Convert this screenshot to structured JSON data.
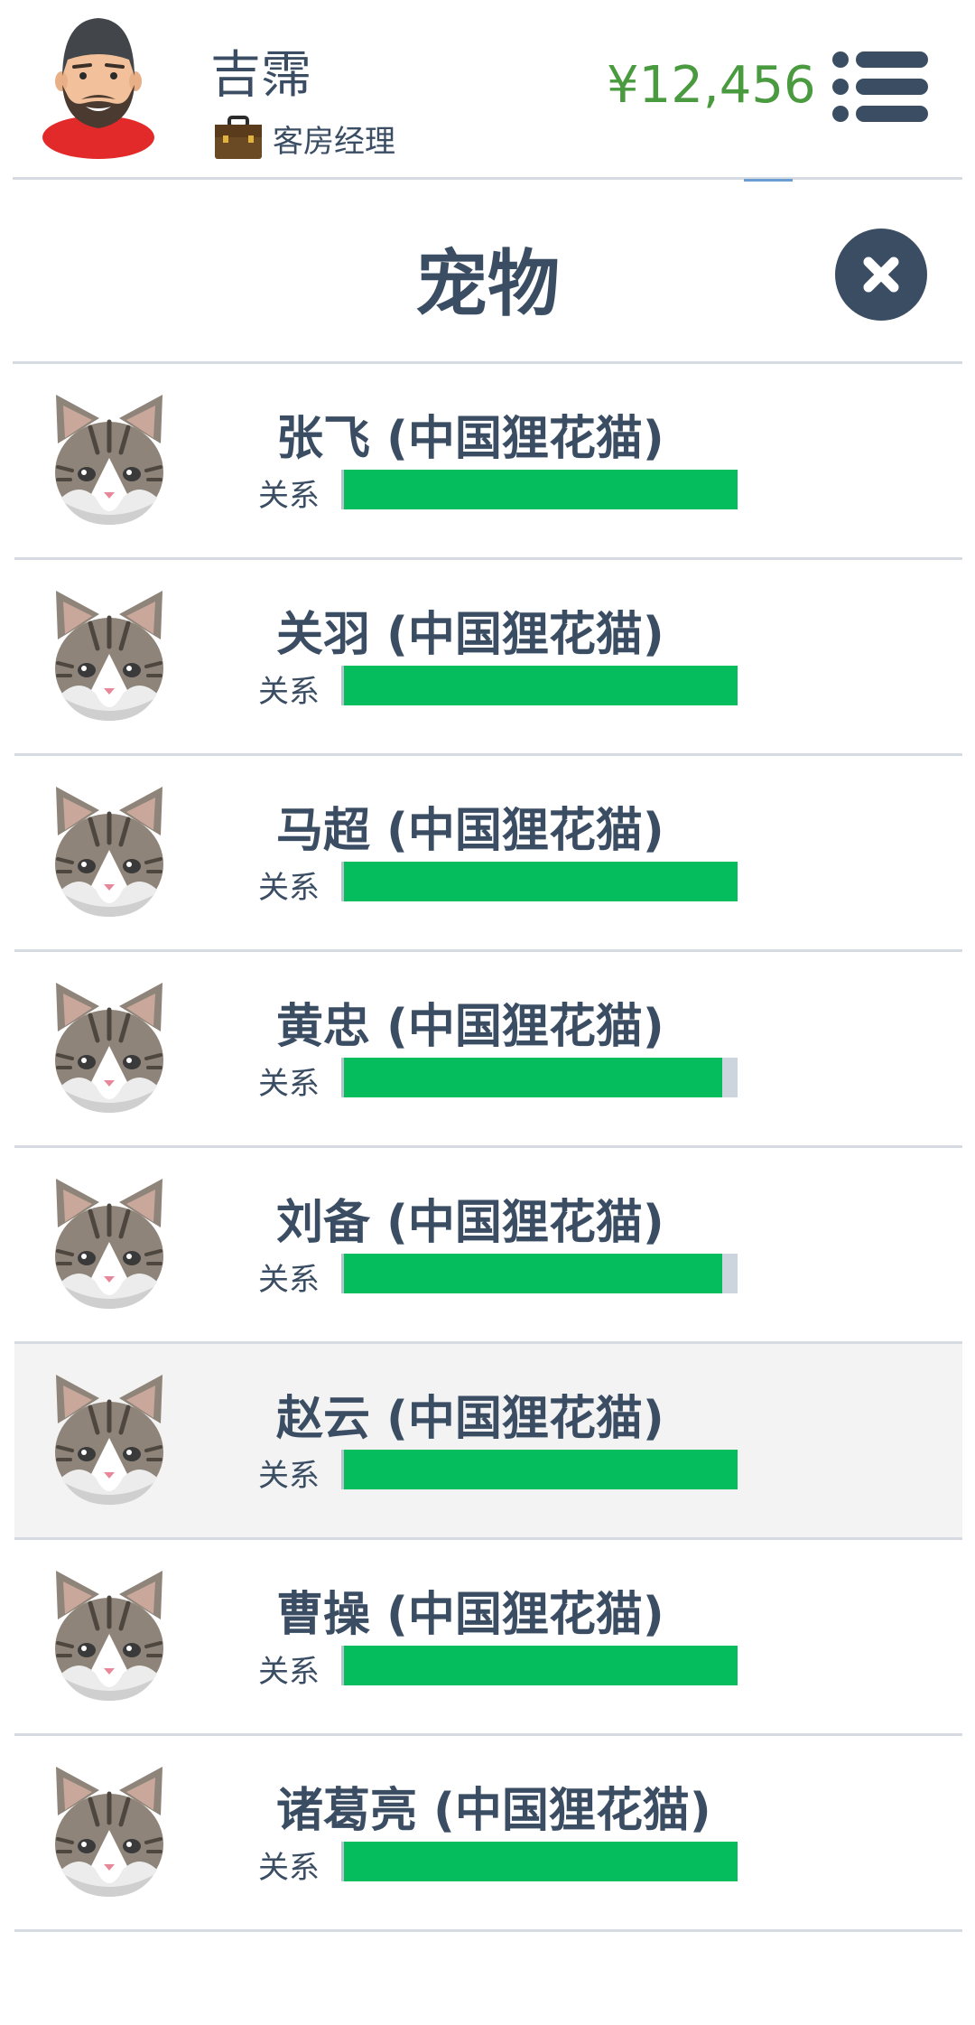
{
  "player": {
    "name": "吉霈",
    "job": "客房经理",
    "money": "¥12,456",
    "avatar_icon": "bearded-man-avatar",
    "job_icon": "briefcase-icon"
  },
  "menu": {
    "icon": "list-menu-icon"
  },
  "panel": {
    "title": "宠物",
    "close_icon": "close-icon"
  },
  "relationship_label": "关系",
  "pets": [
    {
      "name": "张飞 (中国狸花猫)",
      "relationship": 1.0
    },
    {
      "name": "关羽 (中国狸花猫)",
      "relationship": 1.0
    },
    {
      "name": "马超 (中国狸花猫)",
      "relationship": 1.0
    },
    {
      "name": "黄忠 (中国狸花猫)",
      "relationship": 0.96
    },
    {
      "name": "刘备 (中国狸花猫)",
      "relationship": 0.96
    },
    {
      "name": "赵云 (中国狸花猫)",
      "relationship": 1.0,
      "selected": true
    },
    {
      "name": "曹操 (中国狸花猫)",
      "relationship": 1.0
    },
    {
      "name": "诸葛亮 (中国狸花猫)",
      "relationship": 1.0
    }
  ],
  "colors": {
    "money": "#4a9a3f",
    "text": "#3b4d63",
    "bar_fill": "#06bd5d",
    "bar_track": "#ccd5de",
    "selected_row": "#f3f3f3"
  }
}
